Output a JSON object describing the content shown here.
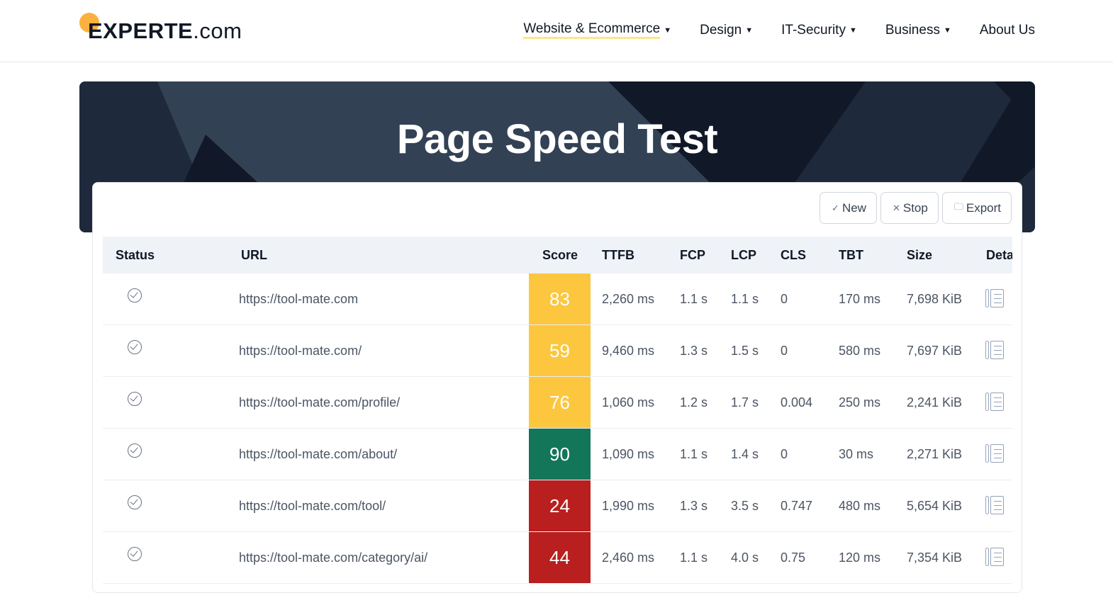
{
  "header": {
    "logo_brand": "EXPERTE",
    "logo_tld": ".com",
    "nav": [
      {
        "label": "Website & Ecommerce",
        "dropdown": true
      },
      {
        "label": "Design",
        "dropdown": true
      },
      {
        "label": "IT-Security",
        "dropdown": true
      },
      {
        "label": "Business",
        "dropdown": true
      },
      {
        "label": "About Us",
        "dropdown": false
      }
    ]
  },
  "banner": {
    "title": "Page Speed Test"
  },
  "toolbar": {
    "new_label": "New",
    "stop_label": "Stop",
    "export_label": "Export"
  },
  "table": {
    "columns": [
      "Status",
      "URL",
      "Score",
      "TTFB",
      "FCP",
      "LCP",
      "CLS",
      "TBT",
      "Size",
      "Details"
    ],
    "rows": [
      {
        "url": "https://tool-mate.com",
        "score": "83",
        "ttfb": "2,260 ms",
        "fcp": "1.1 s",
        "lcp": "1.1 s",
        "cls": "0",
        "tbt": "170 ms",
        "size": "7,698 KiB"
      },
      {
        "url": "https://tool-mate.com/",
        "score": "59",
        "ttfb": "9,460 ms",
        "fcp": "1.3 s",
        "lcp": "1.5 s",
        "cls": "0",
        "tbt": "580 ms",
        "size": "7,697 KiB"
      },
      {
        "url": "https://tool-mate.com/profile/",
        "score": "76",
        "ttfb": "1,060 ms",
        "fcp": "1.2 s",
        "lcp": "1.7 s",
        "cls": "0.004",
        "tbt": "250 ms",
        "size": "2,241 KiB"
      },
      {
        "url": "https://tool-mate.com/about/",
        "score": "90",
        "ttfb": "1,090 ms",
        "fcp": "1.1 s",
        "lcp": "1.4 s",
        "cls": "0",
        "tbt": "30 ms",
        "size": "2,271 KiB"
      },
      {
        "url": "https://tool-mate.com/tool/",
        "score": "24",
        "ttfb": "1,990 ms",
        "fcp": "1.3 s",
        "lcp": "3.5 s",
        "cls": "0.747",
        "tbt": "480 ms",
        "size": "5,654 KiB"
      },
      {
        "url": "https://tool-mate.com/category/ai/",
        "score": "44",
        "ttfb": "2,460 ms",
        "fcp": "1.1 s",
        "lcp": "4.0 s",
        "cls": "0.75",
        "tbt": "120 ms",
        "size": "7,354 KiB"
      }
    ]
  },
  "colors": {
    "score_good": "#137659",
    "score_average": "#fcc73f",
    "score_poor": "#b91f1f",
    "accent": "#fbb040"
  }
}
